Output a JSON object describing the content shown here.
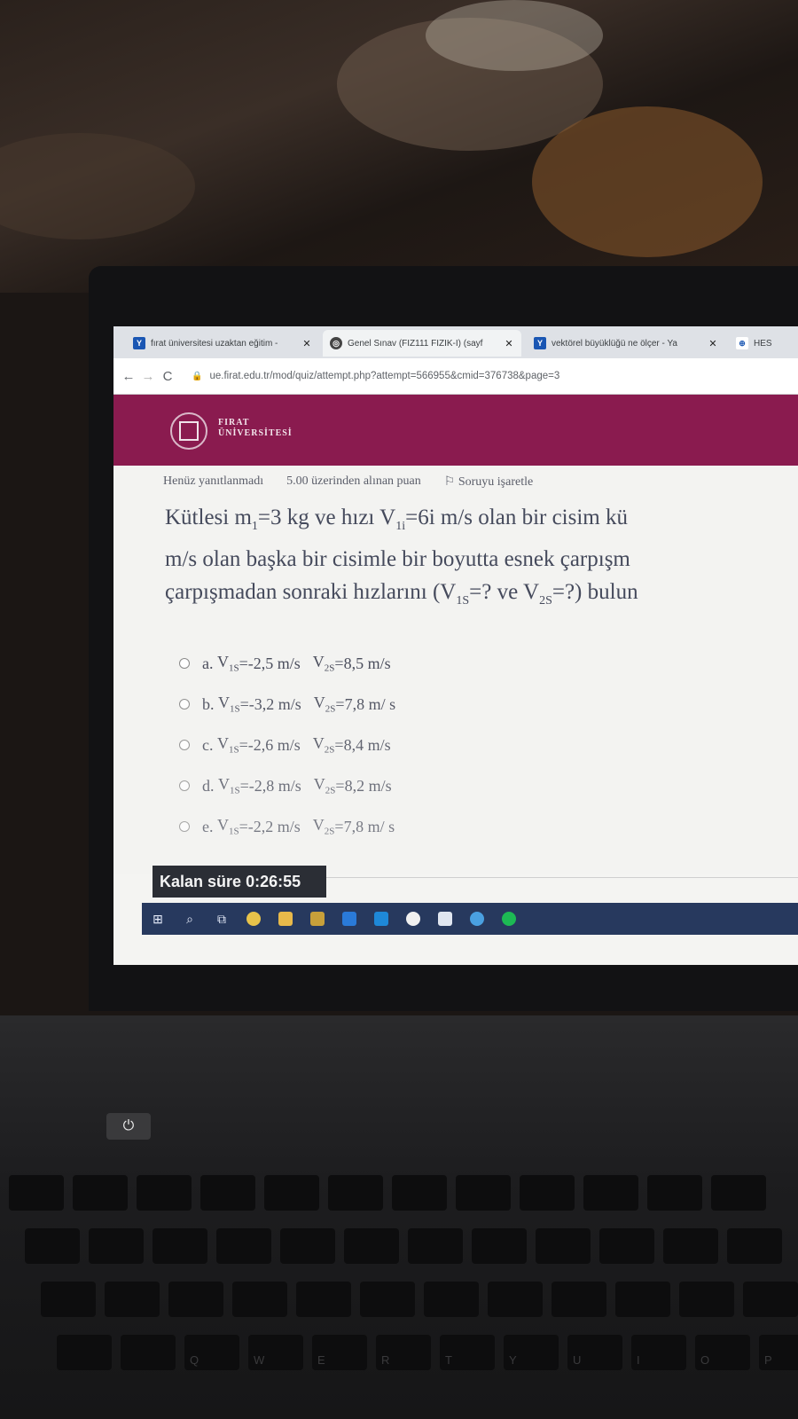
{
  "browser": {
    "tabs": [
      {
        "icon": "y-favicon",
        "title": "fırat üniversitesi uzaktan eğitim -",
        "close": "✕"
      },
      {
        "icon": "globe-favicon",
        "title": "Genel Sınav (FİZ111 FİZİK-I) (sayf",
        "close": "✕"
      },
      {
        "icon": "y-favicon",
        "title": "vektörel büyüklüğü ne ölçer - Ya",
        "close": "✕"
      },
      {
        "icon": "hes-favicon",
        "title": "HES"
      }
    ],
    "url": "ue.firat.edu.tr/mod/quiz/attempt.php?attempt=566955&cmid=376738&page=3"
  },
  "brand": {
    "line1": "FIRAT",
    "line2": "ÜNİVERSİTESİ",
    "color": "#8a1b4f"
  },
  "question": {
    "status": "Henüz yanıtlanmadı",
    "points": "5.00 üzerinden alınan puan",
    "flag_label": "Soruyu işaretle",
    "line1": {
      "a": "Kütlesi m",
      "a_sub": "1",
      "b": "=3 kg  ve  hızı V",
      "b_sub": "1i",
      "c": "=6i m/s  olan bir cisim kü"
    },
    "line2": "m/s  olan başka bir cisimle bir boyutta esnek çarpışm",
    "line3": {
      "a": "çarpışmadan sonraki hızlarını (V",
      "a_sub": "1S",
      "b": "=? ve V",
      "b_sub": "2S",
      "c": "=?) bulun"
    }
  },
  "answers": [
    {
      "letter": "a.",
      "v1": "-2,5 m/s",
      "v2": "8,5 m/s"
    },
    {
      "letter": "b.",
      "v1": "-3,2 m/s",
      "v2": "7,8 m/ s"
    },
    {
      "letter": "c.",
      "v1": "-2,6 m/s",
      "v2": "8,4 m/s"
    },
    {
      "letter": "d.",
      "v1": "-2,8 m/s",
      "v2": "8,2 m/s"
    },
    {
      "letter": "e.",
      "v1": "-2,2 m/s",
      "v2": "7,8 m/ s"
    }
  ],
  "answer_labels": {
    "v": "V",
    "sub1": "1S",
    "sub2": "2S",
    "eq": "= "
  },
  "timer": {
    "label": "Kalan süre",
    "value": "0:26:55"
  },
  "taskbar_icons": [
    "windows-start-icon",
    "search-icon",
    "task-view-icon",
    "chrome-icon",
    "file-explorer-icon",
    "store-icon",
    "edge-icon",
    "mail-icon",
    "yandex-icon",
    "box-icon",
    "app-icon",
    "spotify-icon"
  ],
  "keyboard_labels": [
    "Q",
    "W",
    "E",
    "R",
    "T",
    "Y",
    "U",
    "I",
    "O",
    "P"
  ]
}
